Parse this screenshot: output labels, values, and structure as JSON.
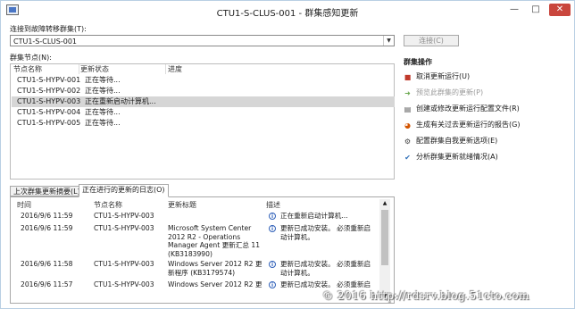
{
  "window": {
    "title": "CTU1-S-CLUS-001 - 群集感知更新",
    "minimize_glyph": "—",
    "maximize_glyph": "□",
    "close_glyph": "✕"
  },
  "connect": {
    "label": "连接到故障转移群集(T):",
    "selected": "CTU1-S-CLUS-001",
    "button": "连接(C)"
  },
  "nodes": {
    "label": "群集节点(N):",
    "columns": [
      "节点名称",
      "更新状态",
      "进度"
    ],
    "rows": [
      {
        "name": "CTU1-S-HYPV-001",
        "status": "正在等待...",
        "progress": ""
      },
      {
        "name": "CTU1-S-HYPV-002",
        "status": "正在等待...",
        "progress": ""
      },
      {
        "name": "CTU1-S-HYPV-003",
        "status": "正在重新启动计算机...",
        "progress": ""
      },
      {
        "name": "CTU1-S-HYPV-004",
        "status": "正在等待...",
        "progress": ""
      },
      {
        "name": "CTU1-S-HYPV-005",
        "status": "正在等待...",
        "progress": ""
      }
    ],
    "selected_index": 2
  },
  "tabs": [
    "上次群集更新摘要(L)",
    "正在进行的更新的日志(O)"
  ],
  "log": {
    "columns": [
      "时间",
      "节点名称",
      "更新标题",
      "描述"
    ],
    "rows": [
      {
        "time": "2016/9/6 11:59",
        "node": "CTU1-S-HYPV-003",
        "title": "",
        "desc": "正在重新启动计算机..."
      },
      {
        "time": "2016/9/6 11:59",
        "node": "CTU1-S-HYPV-003",
        "title": "Microsoft System Center\n2012 R2 - Operations\nManager Agent 更新汇总 11\n(KB3183990)",
        "desc": "更新已成功安装。 必须重新启\n动计算机。"
      },
      {
        "time": "2016/9/6 11:58",
        "node": "CTU1-S-HYPV-003",
        "title": "Windows Server 2012 R2 更\n新程序 (KB3179574)",
        "desc": "更新已成功安装。 必须重新启\n动计算机。"
      },
      {
        "time": "2016/9/6 11:57",
        "node": "CTU1-S-HYPV-003",
        "title": "Windows Server 2012 R2 更",
        "desc": "更新已成功安装。 必须重新启"
      }
    ]
  },
  "actions": {
    "title": "群集操作",
    "items": [
      {
        "label": "取消更新运行(U)",
        "icon": "stop-icon",
        "glyph": "■",
        "color": "#c0392b",
        "enabled": true
      },
      {
        "label": "预览此群集的更新(P)",
        "icon": "arrow-right-icon",
        "glyph": "➜",
        "color": "#6aa84f",
        "enabled": false
      },
      {
        "label": "创建或修改更新运行配置文件(R)",
        "icon": "document-icon",
        "glyph": "▤",
        "color": "#555555",
        "enabled": true
      },
      {
        "label": "生成有关过去更新运行的报告(G)",
        "icon": "report-icon",
        "glyph": "◕",
        "color": "#d35400",
        "enabled": true
      },
      {
        "label": "配置群集自我更新选项(E)",
        "icon": "gear-icon",
        "glyph": "⚙",
        "color": "#444444",
        "enabled": true
      },
      {
        "label": "分析群集更新就绪情况(A)",
        "icon": "checkmark-icon",
        "glyph": "✔",
        "color": "#2e6fb8",
        "enabled": true
      }
    ]
  },
  "watermark": "© 2016 http://rdsrv.blog.51cto.com"
}
